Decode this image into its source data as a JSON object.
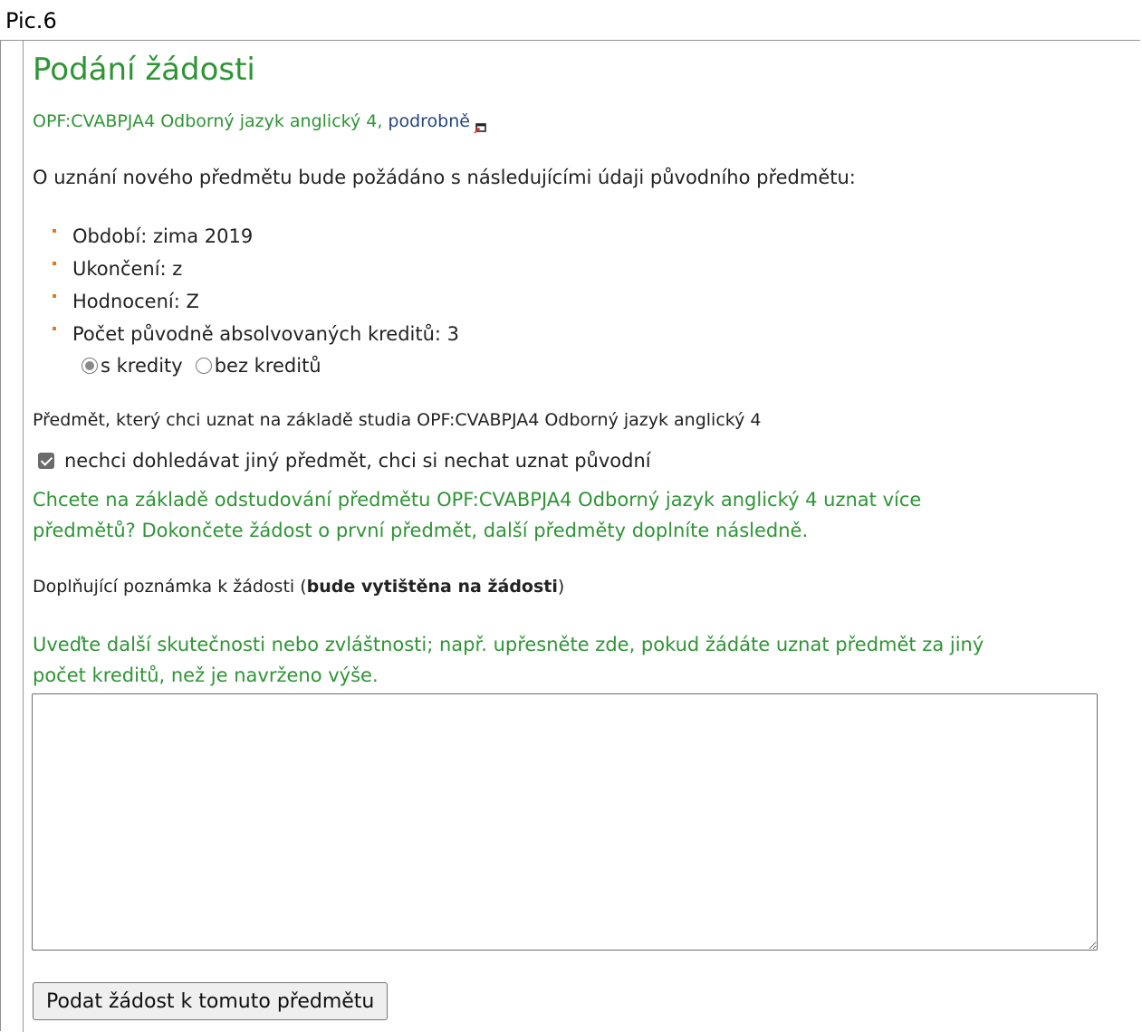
{
  "pic_label": "Pic.6",
  "title": "Podání žádosti",
  "course": {
    "code_name": "OPF:CVABPJA4 Odborný jazyk anglický 4, ",
    "detail_link": "podrobně",
    "detail_icon": "new-window-icon"
  },
  "intro": "O uznání nového předmětu bude požádáno s následujícími údaji původního předmětu:",
  "properties": [
    "Období: zima 2019",
    "Ukončení: z",
    "Hodnocení: Z",
    "Počet původně absolvovaných kreditů: 3"
  ],
  "credit_options": [
    {
      "label": "s kredity",
      "checked": true
    },
    {
      "label": "bez kreditů",
      "checked": false
    }
  ],
  "subject_line": "Předmět, který chci uznat na základě studia OPF:CVABPJA4 Odborný jazyk anglický 4",
  "keep_original": {
    "label": "nechci dohledávat jiný předmět, chci si nechat uznat původní",
    "checked": true
  },
  "more_subjects_hint": "Chcete na základě odstudování předmětu OPF:CVABPJA4 Odborný jazyk anglický 4 uznat více předmětů? Dokončete žádost o první předmět, další předměty doplníte následně.",
  "note": {
    "label_prefix": "Doplňující poznámka k žádosti (",
    "label_bold": "bude vytištěna na žádosti",
    "label_suffix": ")",
    "hint": "Uveďte další skutečnosti nebo zvláštnosti; např. upřesněte zde, pokud žádáte uznat předmět za jiný počet kreditů, než je navrženo výše.",
    "value": ""
  },
  "submit_label": "Podat žádost k tomuto předmětu",
  "colors": {
    "green": "#2e9535",
    "link": "#25477f",
    "bullet": "#e07a2a"
  }
}
